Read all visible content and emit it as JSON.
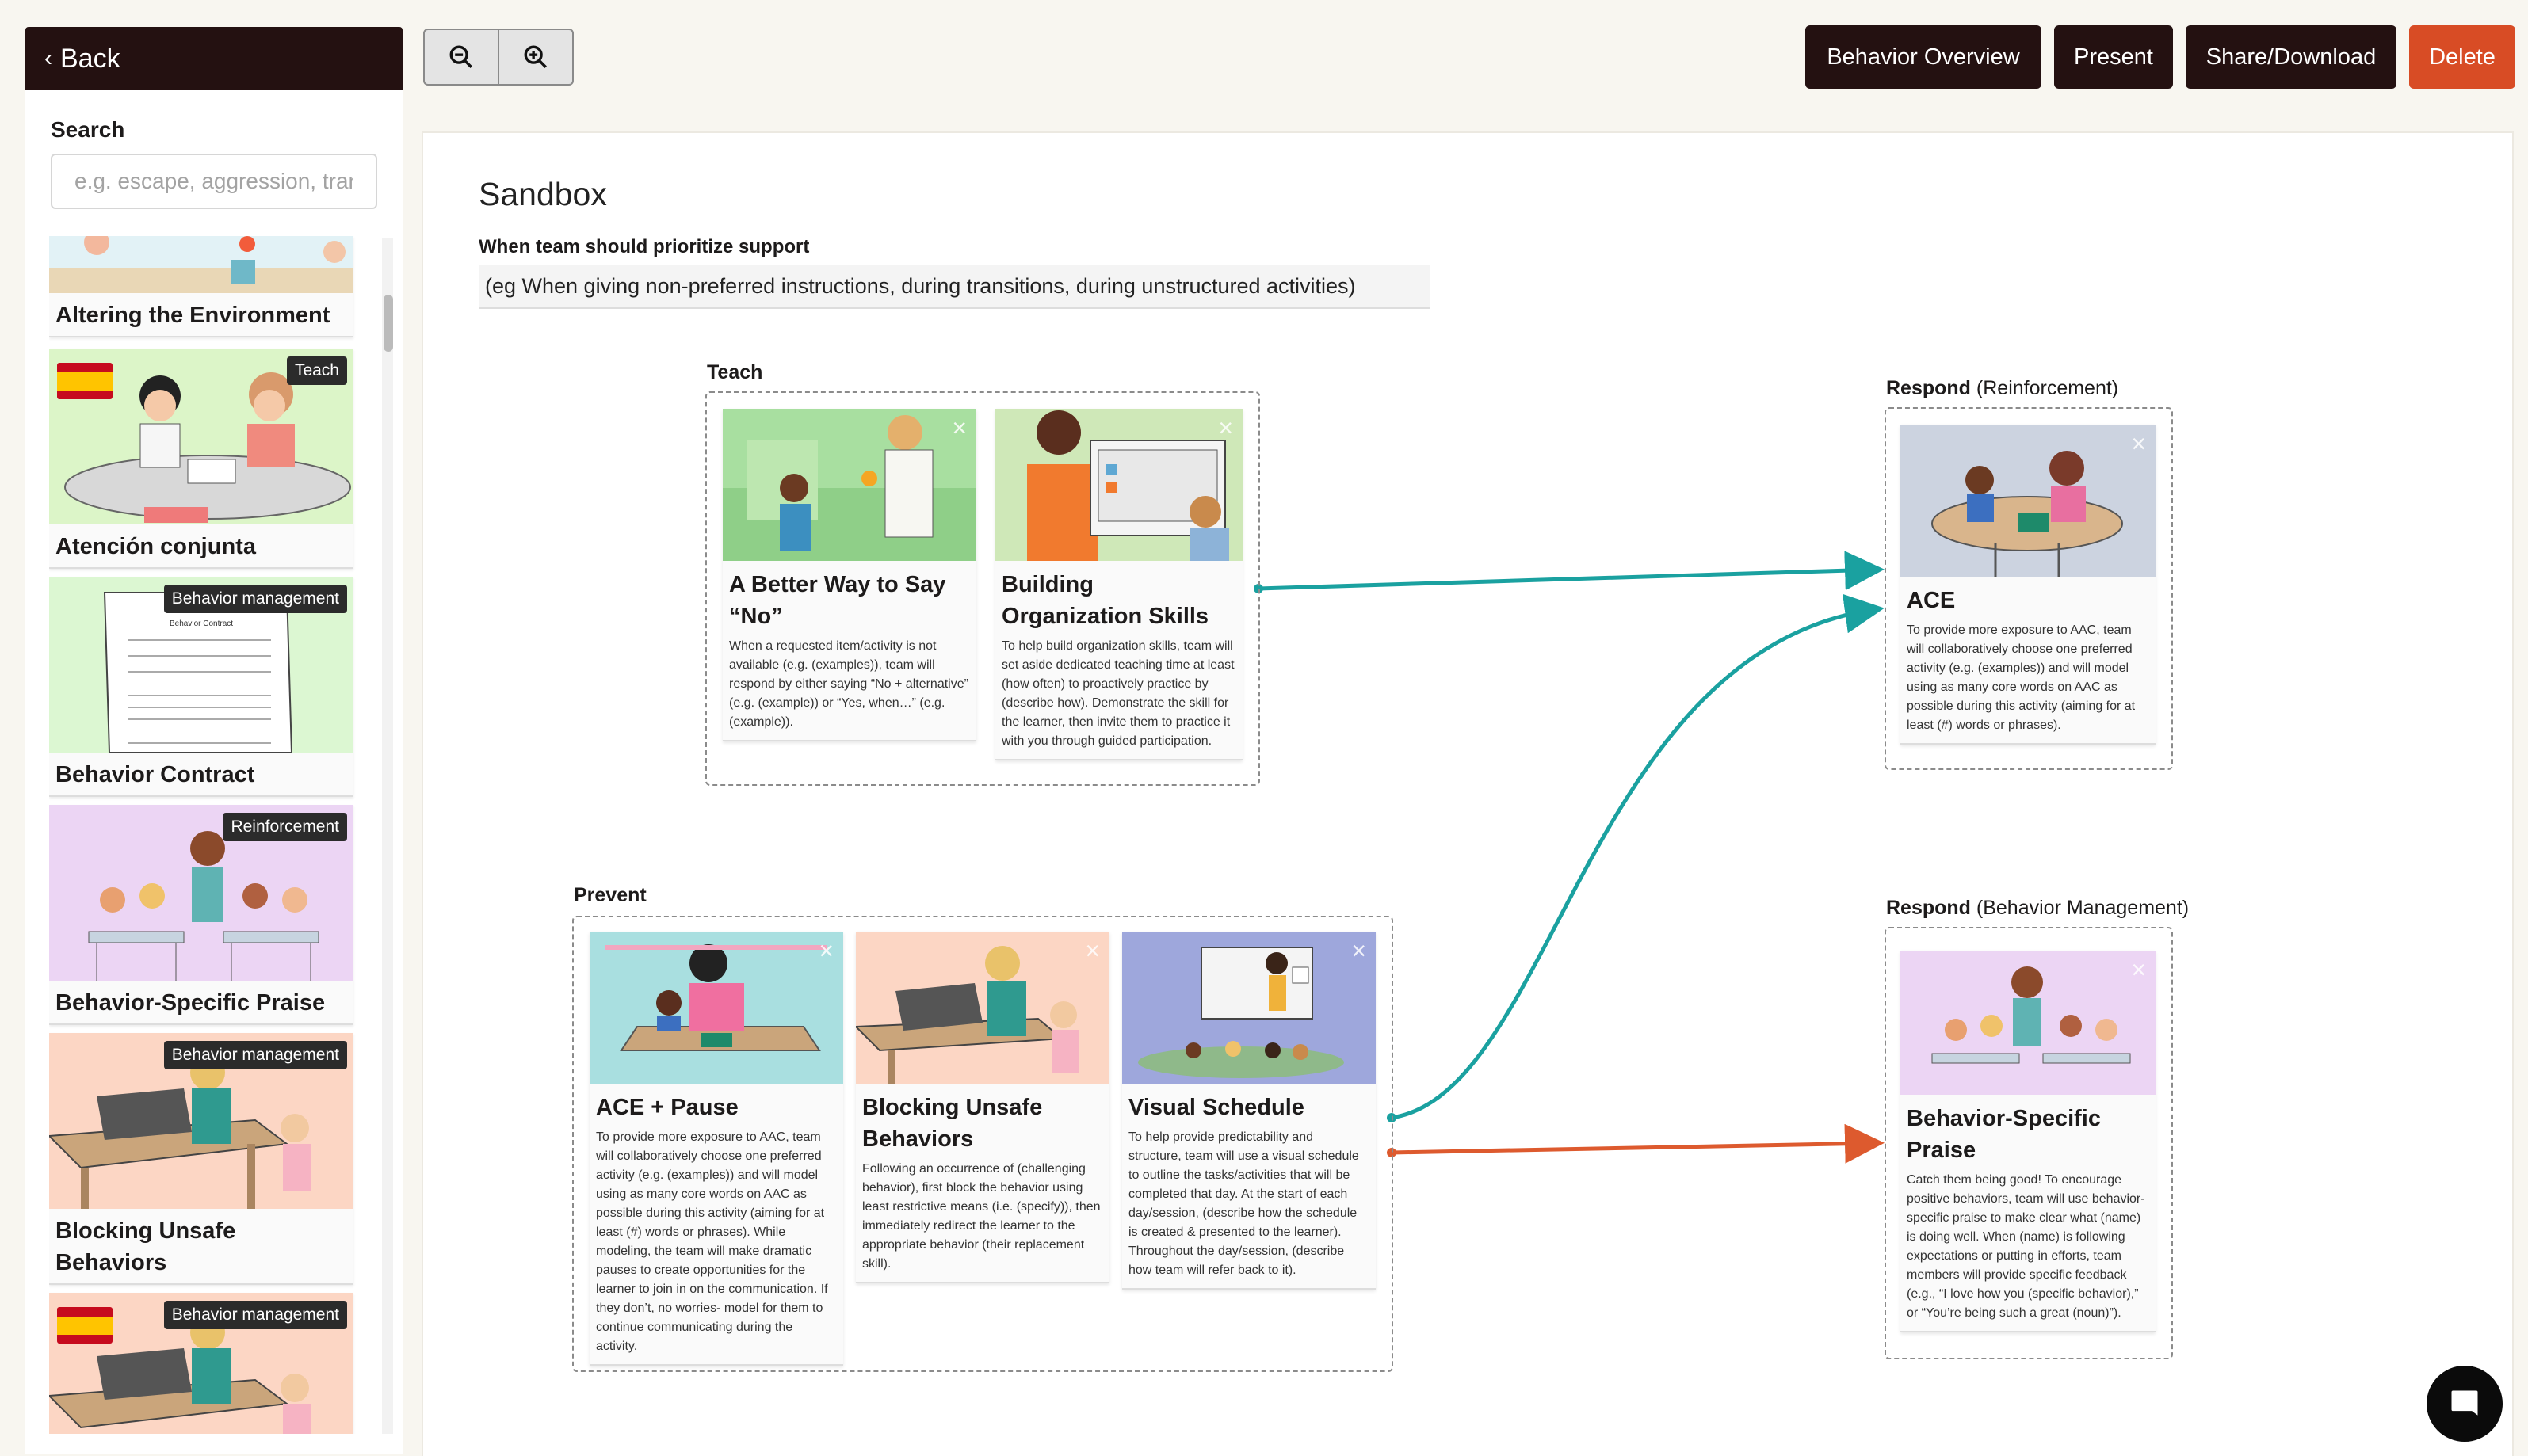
{
  "toolbar": {
    "back_label": "Back",
    "buttons": [
      "Behavior Overview",
      "Present",
      "Share/Download",
      "Delete"
    ]
  },
  "sidebar": {
    "search_label": "Search",
    "search_placeholder": "e.g. escape, aggression, transitions",
    "items": [
      {
        "title": "Altering the Environment",
        "badge": "",
        "flag": false
      },
      {
        "title": "Atención conjunta",
        "badge": "Teach",
        "flag": true
      },
      {
        "title": "Behavior Contract",
        "badge": "Behavior management",
        "flag": false,
        "doc_title": "Behavior Contract"
      },
      {
        "title": "Behavior-Specific Praise",
        "badge": "Reinforcement",
        "flag": false
      },
      {
        "title": "Blocking Unsafe Behaviors",
        "badge": "Behavior management",
        "flag": false
      },
      {
        "title": "",
        "badge": "Behavior management",
        "flag": true
      }
    ]
  },
  "canvas": {
    "title": "Sandbox",
    "priority_label": "When team should prioritize support",
    "priority_value": "(eg When giving non-preferred instructions, during transitions, during unstructured activities)",
    "groups": {
      "teach": {
        "label": "Teach"
      },
      "prevent": {
        "label": "Prevent"
      },
      "respond_reinf": {
        "label": "Respond",
        "sub": "(Reinforcement)"
      },
      "respond_bm": {
        "label": "Respond",
        "sub": "(Behavior Management)"
      }
    },
    "cards": {
      "better_no": {
        "title": "A Better Way to Say “No”",
        "desc": "When a requested item/activity is not available (e.g. (examples)), team will respond by either saying “No + alternative” (e.g. (example)) or “Yes, when…” (e.g. (example))."
      },
      "org_skills": {
        "title": "Building Organization Skills",
        "desc": "To help build organization skills, team will set aside dedicated teaching time at least (how often) to proactively practice by (describe how). Demonstrate the skill for the learner, then invite them to practice it with you through guided participation."
      },
      "ace": {
        "title": "ACE",
        "desc": "To provide more exposure to AAC, team will collaboratively choose one preferred activity (e.g. (examples)) and will model using as many core words on AAC as possible during this activity (aiming for at least (#) words or phrases)."
      },
      "ace_pause": {
        "title": "ACE + Pause",
        "desc": "To provide more exposure to AAC, team will collaboratively choose one preferred activity (e.g. (examples)) and will model using as many core words on AAC as possible during this activity (aiming for at least (#) words or phrases). While modeling, the team will make dramatic pauses to create opportunities for the learner to join in on the communication. If they don’t, no worries- model for them to continue communicating during the activity."
      },
      "blocking": {
        "title": "Blocking Unsafe Behaviors",
        "desc": "Following an occurrence of (challenging behavior), first block the behavior using least restrictive means (i.e. (specify)), then immediately redirect the learner to the appropriate behavior (their replacement skill)."
      },
      "schedule": {
        "title": "Visual Schedule",
        "desc": "To help provide predictability and structure, team will use a visual schedule to outline the tasks/activities that will be completed that day. At the start of each day/session, (describe how the schedule is created & presented to the learner). Throughout the day/session, (describe how team will refer back to it)."
      },
      "bsp": {
        "title": "Behavior-Specific Praise",
        "desc": "Catch them being good! To encourage positive behaviors, team will use behavior-specific praise to make clear what (name) is doing well. When (name) is following expectations or putting in efforts, team members will provide specific feedback (e.g., “I love how you (specific behavior),” or “You’re being such a great (noun)”)."
      }
    }
  },
  "colors": {
    "teal": "#1aa1a0",
    "orange": "#dd5a2e",
    "dark": "#241111",
    "delete": "#d84c25"
  }
}
